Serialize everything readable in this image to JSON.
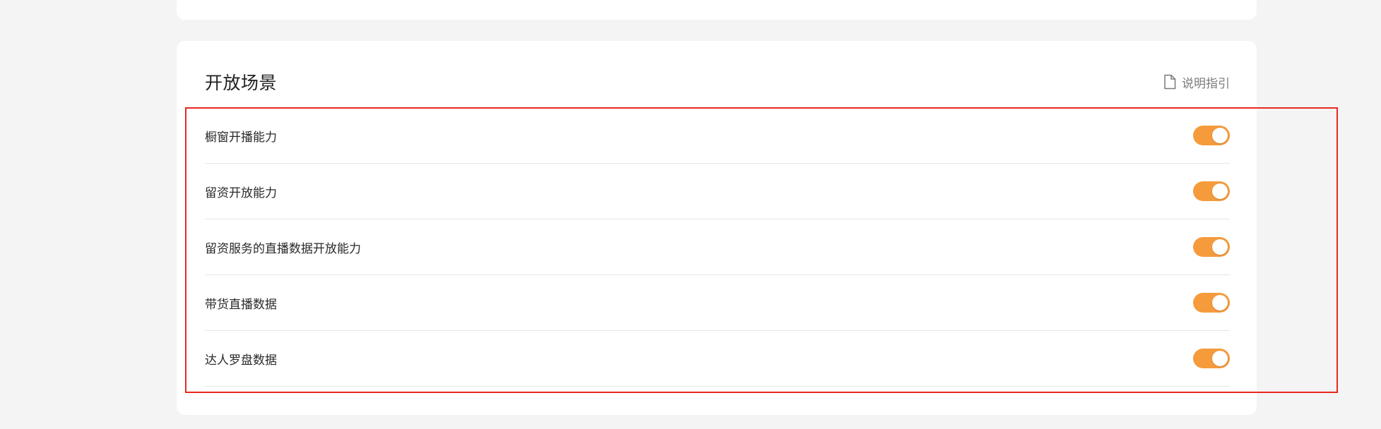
{
  "section": {
    "title": "开放场景",
    "guide_label": "说明指引",
    "guide_icon": "document-icon"
  },
  "scenes": [
    {
      "label": "橱窗开播能力",
      "enabled": true
    },
    {
      "label": "留资开放能力",
      "enabled": true
    },
    {
      "label": "留资服务的直播数据开放能力",
      "enabled": true
    },
    {
      "label": "带货直播数据",
      "enabled": true
    },
    {
      "label": "达人罗盘数据",
      "enabled": true
    }
  ],
  "colors": {
    "toggle_on": "#f59b3c",
    "highlight": "#e8281f",
    "background": "#f4f4f4"
  }
}
